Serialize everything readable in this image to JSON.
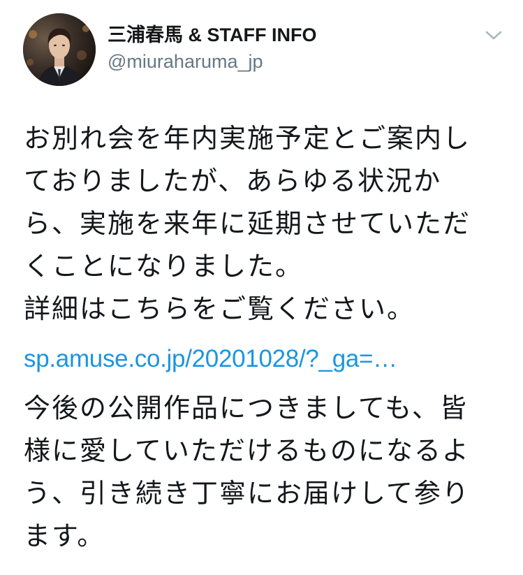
{
  "tweet": {
    "author": {
      "display_name": "三浦春馬 & STAFF INFO",
      "handle": "@miuraharuma_jp",
      "avatar_icon": "profile-photo-avatar"
    },
    "menu_icon": "chevron-down-icon",
    "text_part1": "お別れ会を年内実施予定とご案内し\nておりましたが、あらゆる状況か\nら、実施を来年に延期させていただ\nくことになりました。\n詳細はこちらをご覧ください。",
    "link_text": "sp.amuse.co.jp/20201028/?_ga=…",
    "text_part2": "今後の公開作品につきましても、皆\n様に愛していただけるものになるよ\nう、引き続き丁寧にお届けして参り\nます。"
  },
  "colors": {
    "text": "#14171a",
    "secondary": "#657786",
    "link": "#1b95e0",
    "caret": "#aab8c2"
  }
}
